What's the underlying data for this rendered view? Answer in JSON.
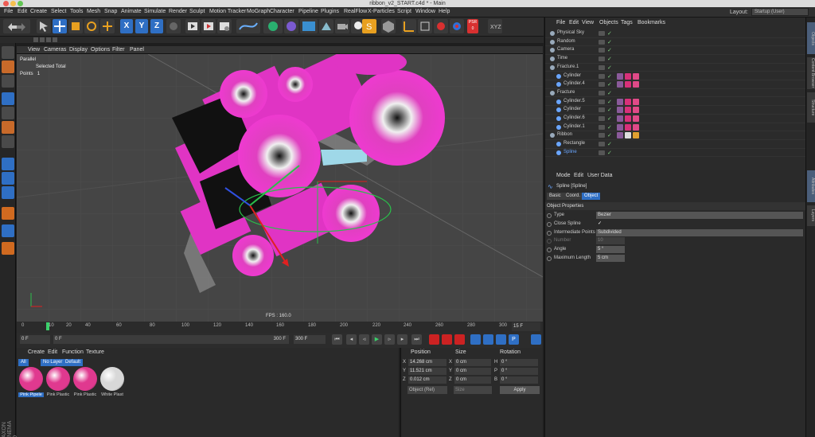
{
  "window": {
    "title": "ribbon_v2_START.c4d * - Main"
  },
  "menubar": {
    "items": [
      "File",
      "Edit",
      "Create",
      "Select",
      "Tools",
      "Mesh",
      "Snap",
      "Animate",
      "Simulate",
      "Render",
      "Sculpt",
      "Motion Tracker",
      "MoGraph",
      "Character",
      "Pipeline",
      "Plugins",
      "RealFlow",
      "X-Particles",
      "Script",
      "Window",
      "Help"
    ],
    "layout_label": "Layout:",
    "layout_value": "Startup (User)"
  },
  "toolbar": {
    "axis_labels": [
      "X",
      "Y",
      "Z"
    ],
    "psr_label": "PSR",
    "psr_value": "0"
  },
  "viewport": {
    "menu": [
      "View",
      "Cameras",
      "Display",
      "Options",
      "Filter",
      "Panel"
    ],
    "projection": "Parallel",
    "info_header": "Selected Total",
    "info_points_label": "Points",
    "info_points_value": "1",
    "fps": "FPS : 160.0"
  },
  "timeline": {
    "ticks": [
      "0",
      "10",
      "20",
      "40",
      "60",
      "80",
      "100",
      "120",
      "140",
      "160",
      "180",
      "200",
      "220",
      "240",
      "260",
      "280",
      "300"
    ],
    "end_frame_label": "15 F"
  },
  "playback": {
    "current_frame": "0 F",
    "slider_start": "0 F",
    "slider_end": "300 F",
    "max_frame": "300 F"
  },
  "materials": {
    "menu": [
      "Create",
      "Edit",
      "Function",
      "Texture"
    ],
    "filters": [
      "All",
      "No Layer",
      "Default"
    ],
    "items": [
      {
        "name": "Pink Pipele",
        "color": "#e0398f"
      },
      {
        "name": "Pink Plastic",
        "color": "#e0398f"
      },
      {
        "name": "Pink Plastic",
        "color": "#e0398f"
      },
      {
        "name": "White Plast",
        "color": "#d8d8d8"
      }
    ],
    "brand": "MAXON CINEMA 4D"
  },
  "coordinates": {
    "headers": [
      "Position",
      "Size",
      "Rotation"
    ],
    "rows": [
      {
        "axis": "X",
        "pos": "14.268 cm",
        "size_axis": "X",
        "size": "0 cm",
        "rot_axis": "H",
        "rot": "0 °"
      },
      {
        "axis": "Y",
        "pos": "11.521 cm",
        "size_axis": "Y",
        "size": "0 cm",
        "rot_axis": "P",
        "rot": "0 °"
      },
      {
        "axis": "Z",
        "pos": "0.012 cm",
        "size_axis": "Z",
        "size": "0 cm",
        "rot_axis": "B",
        "rot": "0 °"
      }
    ],
    "mode": "Object (Rel)",
    "size_mode": "Size",
    "apply_label": "Apply"
  },
  "object_manager": {
    "menu": [
      "File",
      "Edit",
      "View",
      "Objects",
      "Tags",
      "Bookmarks"
    ],
    "rows": [
      {
        "name": "Physical Sky",
        "indent": 0,
        "selected": false,
        "tags": []
      },
      {
        "name": "Random",
        "indent": 0,
        "selected": false,
        "tags": []
      },
      {
        "name": "Camera",
        "indent": 0,
        "selected": false,
        "tags": []
      },
      {
        "name": "Time",
        "indent": 0,
        "selected": false,
        "tags": []
      },
      {
        "name": "Fracture.1",
        "indent": 0,
        "selected": false,
        "tags": []
      },
      {
        "name": "Cylinder",
        "indent": 1,
        "selected": false,
        "tags": [
          "#8a5a9a",
          "#d8307a",
          "#e04a88"
        ]
      },
      {
        "name": "Cylinder.4",
        "indent": 1,
        "selected": false,
        "tags": [
          "#8a5a9a",
          "#d8307a",
          "#e04a88"
        ]
      },
      {
        "name": "Fracture",
        "indent": 0,
        "selected": false,
        "tags": []
      },
      {
        "name": "Cylinder.5",
        "indent": 1,
        "selected": false,
        "tags": [
          "#8a5a9a",
          "#d8307a",
          "#e04a88"
        ]
      },
      {
        "name": "Cylinder",
        "indent": 1,
        "selected": false,
        "tags": [
          "#8a5a9a",
          "#d8307a",
          "#e04a88"
        ]
      },
      {
        "name": "Cylinder.6",
        "indent": 1,
        "selected": false,
        "tags": [
          "#8a5a9a",
          "#d8307a",
          "#e04a88"
        ]
      },
      {
        "name": "Cylinder.1",
        "indent": 1,
        "selected": false,
        "tags": [
          "#8a5a9a",
          "#d8307a",
          "#e04a88"
        ]
      },
      {
        "name": "Ribbon",
        "indent": 0,
        "selected": false,
        "tags": [
          "#8a5a9a",
          "#dddddd",
          "#e0a030"
        ]
      },
      {
        "name": "Rectangle",
        "indent": 1,
        "selected": false,
        "tags": []
      },
      {
        "name": "Spline",
        "indent": 1,
        "selected": true,
        "tags": []
      }
    ]
  },
  "attribute_manager": {
    "menu": [
      "Mode",
      "Edit",
      "User Data"
    ],
    "object_title": "Spline [Spline]",
    "tabs": [
      "Basic",
      "Coord.",
      "Object"
    ],
    "active_tab": "Object",
    "section": "Object Properties",
    "props": [
      {
        "label": "Type",
        "value": "Bezier",
        "kind": "dropdown",
        "enabled": true
      },
      {
        "label": "Close Spline",
        "value": "✓",
        "kind": "check",
        "enabled": true
      },
      {
        "label": "Intermediate Points",
        "value": "Subdivided",
        "kind": "dropdown",
        "enabled": true
      },
      {
        "label": "Number",
        "value": "10",
        "kind": "number",
        "enabled": false
      },
      {
        "label": "Angle",
        "value": "5 °",
        "kind": "number",
        "enabled": true
      },
      {
        "label": "Maximum Length",
        "value": "5 cm",
        "kind": "number",
        "enabled": true
      }
    ]
  },
  "right_tabs": [
    "Objects",
    "Content Browser",
    "Structure",
    "Attributes",
    "Layers"
  ],
  "colors": {
    "accent": "#2f6fc4",
    "pink": "#e0398f",
    "selection": "#6aa6ff"
  }
}
